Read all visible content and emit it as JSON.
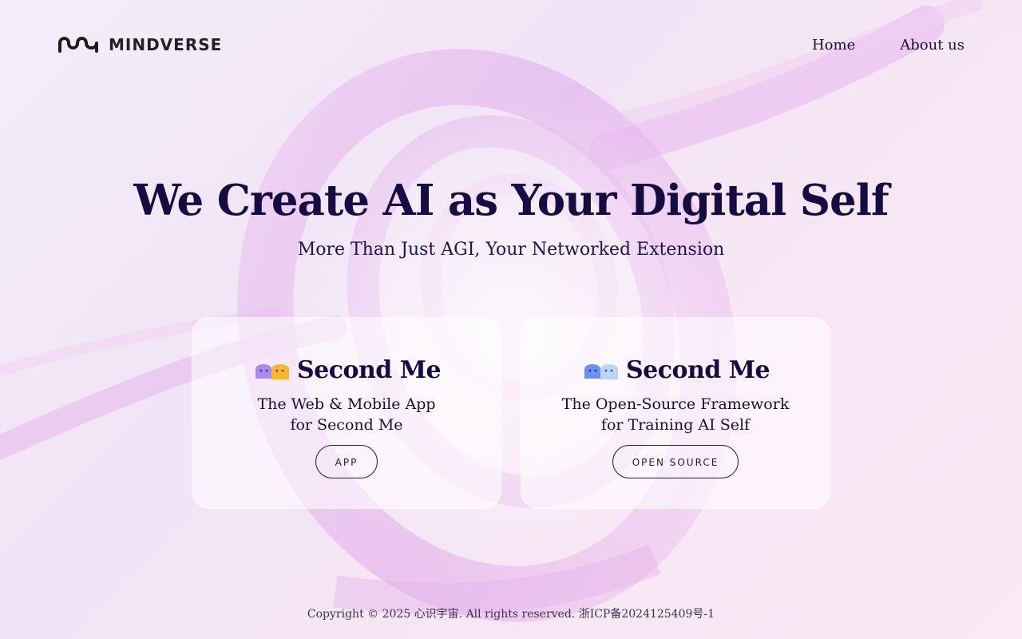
{
  "header": {
    "brand": "MINDVERSE",
    "nav": [
      {
        "label": "Home"
      },
      {
        "label": "About us"
      }
    ]
  },
  "hero": {
    "title": "We Create AI as Your Digital Self",
    "subtitle": "More Than Just AGI, Your Networked Extension"
  },
  "cards": [
    {
      "title": "Second Me",
      "desc_line1": "The Web & Mobile App",
      "desc_line2": "for Second Me",
      "button": "APP",
      "mascot_colors": [
        "#a78bf0",
        "#f7b731"
      ]
    },
    {
      "title": "Second Me",
      "desc_line1": "The Open-Source Framework",
      "desc_line2": "for Training AI Self",
      "button": "OPEN SOURCE",
      "mascot_colors": [
        "#6d8ef2",
        "#b9d6f7"
      ]
    }
  ],
  "footer": {
    "copyright": "Copyright © 2025 心识宇宙. All rights reserved. 浙ICP备2024125409号-1"
  },
  "theme": {
    "text": "#150d42",
    "swirl": "#e2b4ea"
  }
}
